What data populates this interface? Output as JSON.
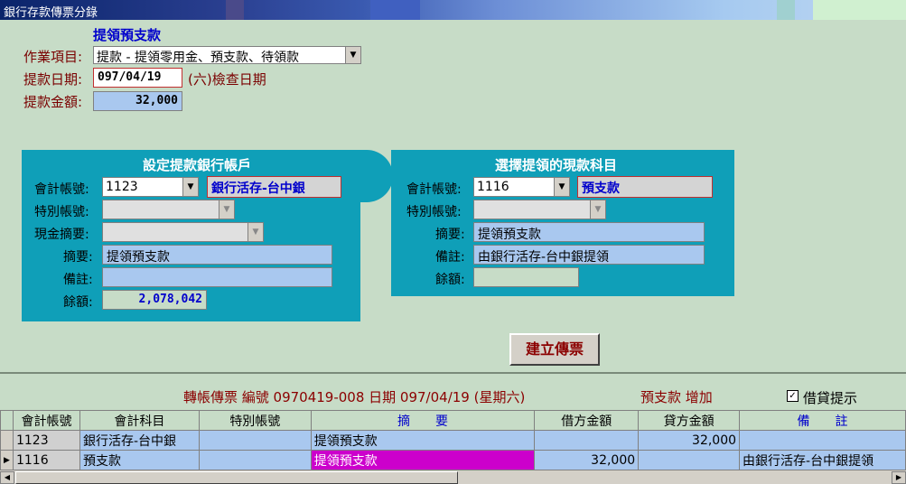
{
  "window": {
    "title": "銀行存款傳票分錄"
  },
  "header": {
    "heading": "提領預支款",
    "job_label": "作業項目:",
    "job_value": "提款 - 提領零用金、預支款、待領款",
    "date_label": "提款日期:",
    "date_value": "097/04/19",
    "date_note": "(六)檢查日期",
    "amount_label": "提款金額:",
    "amount_value": "32,000"
  },
  "left_panel": {
    "title": "設定提款銀行帳戶",
    "account_label": "會計帳號:",
    "account_value": "1123",
    "account_name": "銀行活存-台中銀",
    "special_label": "特別帳號:",
    "special_value": "",
    "cash_label": "現金摘要:",
    "cash_value": "",
    "summary_label": "摘要:",
    "summary_value": "提領預支款",
    "note_label": "備註:",
    "note_value": "",
    "balance_label": "餘額:",
    "balance_value": "2,078,042"
  },
  "right_panel": {
    "title": "選擇提領的現款科目",
    "account_label": "會計帳號:",
    "account_value": "1116",
    "account_name": "預支款",
    "special_label": "特別帳號:",
    "special_value": "",
    "summary_label": "摘要:",
    "summary_value": "提領預支款",
    "note_label": "備註:",
    "note_value": "由銀行活存-台中銀提領",
    "balance_label": "餘額:",
    "balance_value": ""
  },
  "actions": {
    "create_voucher": "建立傳票"
  },
  "voucher_info": {
    "text": "轉帳傳票 編號 0970419-008 日期 097/04/19 (星期六)",
    "status": "預支款 增加",
    "checkbox_label": "借貸提示",
    "checkbox_checked": true,
    "checkbox_mark": "✓"
  },
  "grid": {
    "columns": [
      "會計帳號",
      "會計科目",
      "特別帳號",
      "摘　　要",
      "借方金額",
      "貸方金額",
      "備　　註"
    ],
    "rows": [
      {
        "account": "1123",
        "subject": "銀行活存-台中銀",
        "special": "",
        "summary": "提領預支款",
        "debit": "",
        "credit": "32,000",
        "note": ""
      },
      {
        "account": "1116",
        "subject": "預支款",
        "special": "",
        "summary": "提領預支款",
        "debit": "32,000",
        "credit": "",
        "note": "由銀行活存-台中銀提領"
      }
    ]
  },
  "colors": {
    "background": "#c7dcc7",
    "panel": "#0f9fb8",
    "field_blue": "#a9c8ef",
    "label_red": "#7a0000",
    "heading_blue": "#0000cc",
    "highlight": "#cc00cc"
  }
}
